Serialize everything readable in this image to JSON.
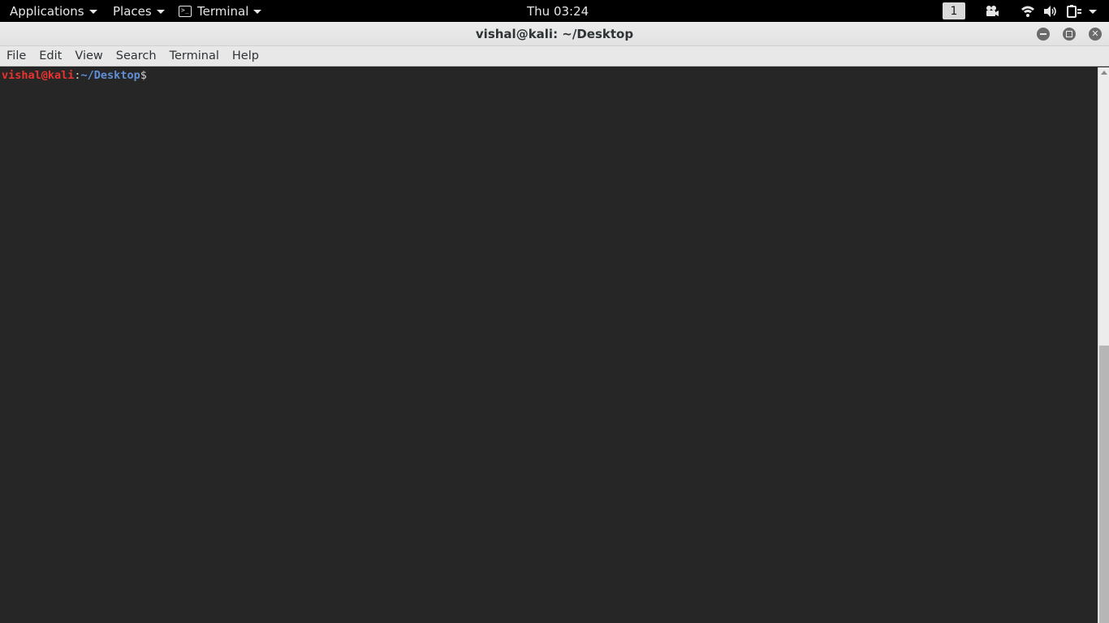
{
  "panel": {
    "applications_label": "Applications",
    "places_label": "Places",
    "app_label": "Terminal",
    "clock": "Thu 03:24",
    "workspace_number": "1",
    "icons": [
      "video-camera-icon",
      "wifi-icon",
      "volume-icon",
      "power-icon",
      "chevron-down-icon"
    ]
  },
  "window": {
    "title": "vishal@kali: ~/Desktop",
    "buttons": [
      "minimize-icon",
      "maximize-icon",
      "close-icon"
    ]
  },
  "menubar": {
    "items": [
      "File",
      "Edit",
      "View",
      "Search",
      "Terminal",
      "Help"
    ]
  },
  "terminal": {
    "prompt_user": "vishal@kali",
    "prompt_separator": ":",
    "prompt_path": "~/Desktop",
    "prompt_symbol": "$"
  },
  "colors": {
    "panel_bg": "#000000",
    "terminal_bg": "#262626",
    "prompt_user": "#e8342f",
    "prompt_path": "#5f8fd7",
    "titlebar_bg": "#e8e8e8"
  }
}
